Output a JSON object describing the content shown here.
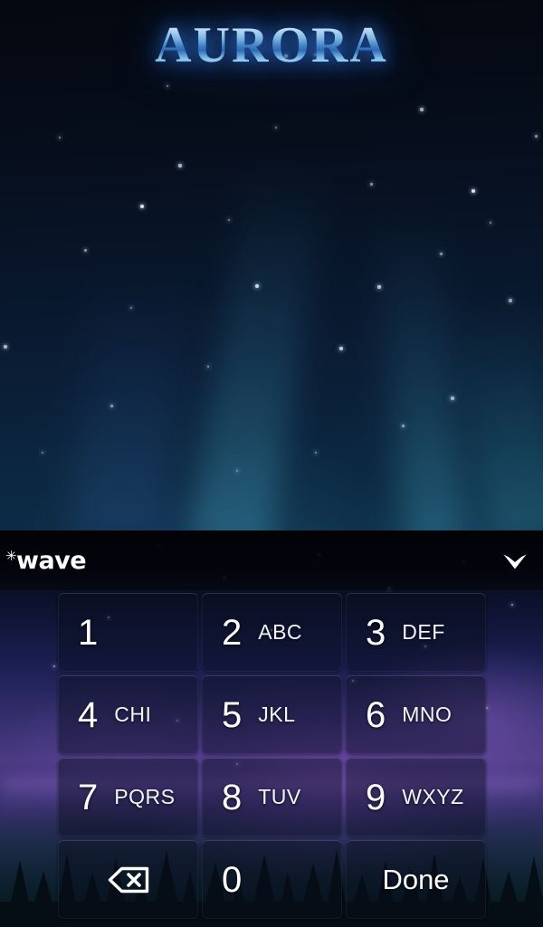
{
  "wallpaper": {
    "app_title": "AURORA",
    "title_color": "#9ecdf0",
    "background_color": "#071020",
    "aurora_color": "#4aa8c8"
  },
  "keyboard": {
    "logo": {
      "text": "wave",
      "sparkle_glyph": "✳",
      "color": "#ffffff"
    },
    "collapse_button": {
      "icon": "chevron-down-icon",
      "color": "#ffffff"
    },
    "panel_color": "#030305",
    "keys": [
      {
        "num": "1",
        "letters": "",
        "type": "digit"
      },
      {
        "num": "2",
        "letters": "ABC",
        "type": "digit"
      },
      {
        "num": "3",
        "letters": "DEF",
        "type": "digit"
      },
      {
        "num": "4",
        "letters": "CHI",
        "type": "digit"
      },
      {
        "num": "5",
        "letters": "JKL",
        "type": "digit"
      },
      {
        "num": "6",
        "letters": "MNO",
        "type": "digit"
      },
      {
        "num": "7",
        "letters": "PQRS",
        "type": "digit"
      },
      {
        "num": "8",
        "letters": "TUV",
        "type": "digit"
      },
      {
        "num": "9",
        "letters": "WXYZ",
        "type": "digit"
      },
      {
        "num": "",
        "letters": "",
        "type": "backspace",
        "icon": "backspace-icon"
      },
      {
        "num": "0",
        "letters": "",
        "type": "digit"
      },
      {
        "num": "",
        "letters": "",
        "type": "action",
        "label": "Done"
      }
    ]
  }
}
